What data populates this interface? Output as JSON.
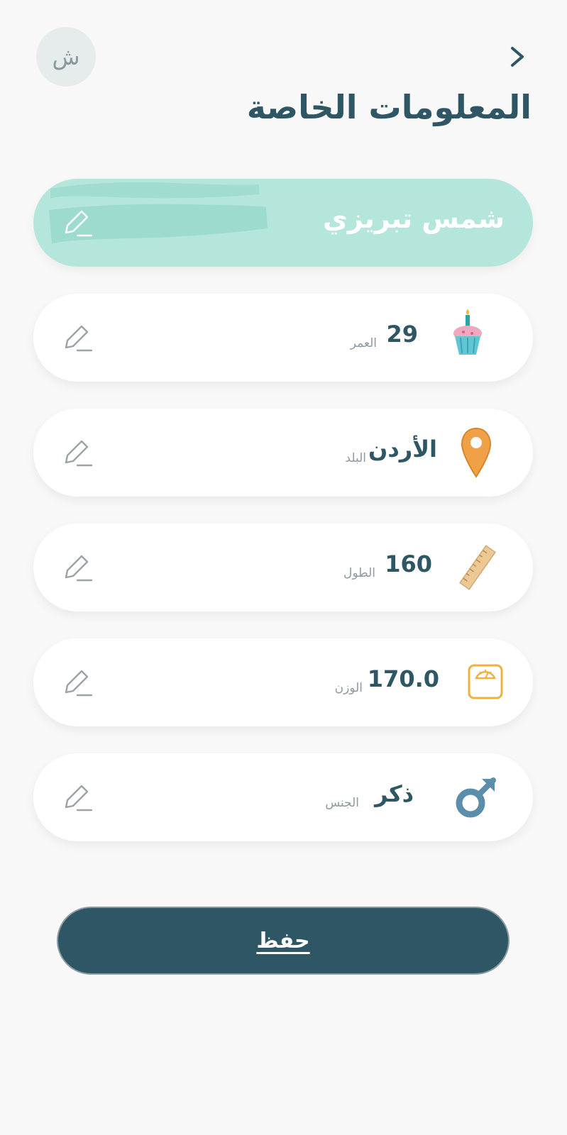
{
  "header": {
    "avatar_initial": "ش",
    "title": "المعلومات الخاصة"
  },
  "profile": {
    "name": "شمس تبريزي",
    "fields": [
      {
        "label": "العمر",
        "value": "29",
        "icon": "cupcake-icon"
      },
      {
        "label": "البلد",
        "value": "الأردن",
        "icon": "location-pin-icon"
      },
      {
        "label": "الطول",
        "value": "160",
        "icon": "ruler-icon"
      },
      {
        "label": "الوزن",
        "value": "170.0",
        "icon": "scale-icon"
      },
      {
        "label": "الجنس",
        "value": "ذكر",
        "icon": "male-icon"
      }
    ]
  },
  "actions": {
    "save_label": "حفظ"
  },
  "colors": {
    "primary": "#2e5665",
    "name_card": "#b4e6dc",
    "background": "#f8f8f8"
  }
}
